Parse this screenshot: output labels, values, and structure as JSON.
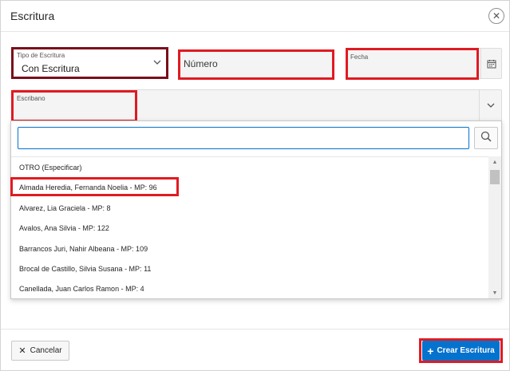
{
  "dialog": {
    "title": "Escritura",
    "close_icon": "close-icon"
  },
  "form": {
    "tipo": {
      "label": "Tipo de Escritura",
      "value": "Con Escritura",
      "icon": "chevron-down-icon"
    },
    "numero": {
      "placeholder": "Número"
    },
    "fecha": {
      "label": "Fecha",
      "icon": "calendar-icon"
    },
    "escribano": {
      "label": "Escribano",
      "icon": "chevron-down-icon"
    }
  },
  "popup": {
    "search_value": "",
    "search_icon": "search-icon",
    "items": [
      "OTRO (Especificar)",
      "Almada Heredia, Fernanda Noelia - MP: 96",
      "Alvarez, Lia Graciela - MP: 8",
      "Avalos, Ana Silvia - MP: 122",
      "Barrancos Juri, Nahir Albeana - MP: 109",
      "Brocal de Castillo, Silvia Susana - MP: 11",
      "Canellada, Juan Carlos Ramon - MP: 4"
    ]
  },
  "footer": {
    "cancel_label": "Cancelar",
    "create_label": "Crear Escritura"
  },
  "colors": {
    "highlight_red": "#e01b22",
    "highlight_dark": "#7a0f1a",
    "primary": "#0572ce"
  }
}
